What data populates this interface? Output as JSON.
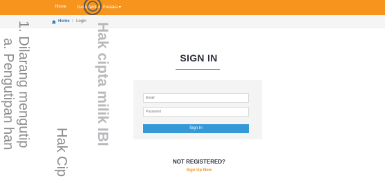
{
  "navbar": {
    "home_label": "Home",
    "dropdown_label": "Dokumentasi Pustaka"
  },
  "breadcrumb": {
    "home_label": "Home",
    "separator": "/",
    "current_label": "Login"
  },
  "page": {
    "title": "SIGN IN"
  },
  "form": {
    "email_placeholder": "Email",
    "password_placeholder": "Password",
    "signin_label": "Sign In"
  },
  "register": {
    "question": "NOT REGISTERED?",
    "signup_label": "Sign Up Now"
  },
  "watermark": {
    "line1": "1. Dilarang mengutip",
    "line2": "a. Pengutipan han",
    "line3": "Hak Cip",
    "line4": "Hak cipta milik IBI"
  },
  "colors": {
    "navbar": "#f7941d",
    "accent": "#3499d6",
    "heading": "#2a2f3a",
    "link_orange": "#f7941d"
  },
  "icons": {
    "breadcrumb_home": "home-icon",
    "watermark_logo": "seal-logo-icon"
  }
}
